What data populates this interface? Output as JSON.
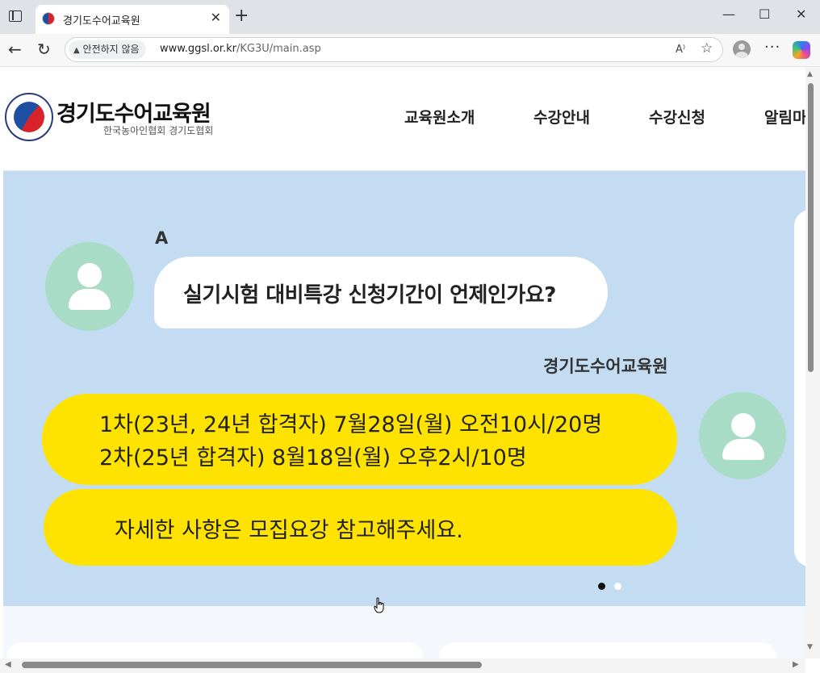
{
  "browser": {
    "tab_title": "경기도수어교육원",
    "security_label": "안전하지 않음",
    "url_host": "www.ggsl.or.kr",
    "url_path": "/KG3U/main.asp",
    "icons": {
      "window": "window-menu-icon",
      "favicon": "site-favicon",
      "close_tab": "close-icon",
      "new_tab": "plus-icon",
      "minimize": "minimize-icon",
      "maximize": "maximize-icon",
      "close_window": "close-window-icon",
      "back": "back-arrow-icon",
      "reload": "reload-icon",
      "warning": "warning-icon",
      "read_aloud": "read-aloud-icon",
      "favorite": "star-icon",
      "profile": "profile-icon",
      "more": "more-icon",
      "copilot": "copilot-icon"
    },
    "glyphs": {
      "close_tab": "✕",
      "new_tab": "+",
      "minimize": "—",
      "maximize": "☐",
      "close_window": "✕",
      "back": "←",
      "reload": "↻",
      "warning": "▲",
      "read_aloud": "A⁾",
      "favorite": "☆",
      "more": "···"
    }
  },
  "site": {
    "title": "경기도수어교육원",
    "subtitle": "한국농아인협회 경기도협회",
    "nav": [
      "교육원소개",
      "수강안내",
      "수강신청",
      "알림마"
    ]
  },
  "chat": {
    "question_author": "A",
    "question": "실기시험 대비특강 신청기간이 언제인가요?",
    "answer_author": "경기도수어교육원",
    "answer_lines": [
      "1차(23년, 24년 합격자) 7월28일(월) 오전10시/20명",
      "2차(25년 합격자) 8월18일(월) 오후2시/10명"
    ],
    "answer_note": "자세한 사항은 모집요강 참고해주세요."
  },
  "carousel": {
    "total_slides": 2,
    "active_slide": 1
  },
  "colors": {
    "hero_bg": "#c4dcf1",
    "answer_bubble": "#ffe300",
    "avatar_bg": "#a8dcc7",
    "dot_active": "#111111",
    "dot_inactive": "#ffffff"
  }
}
